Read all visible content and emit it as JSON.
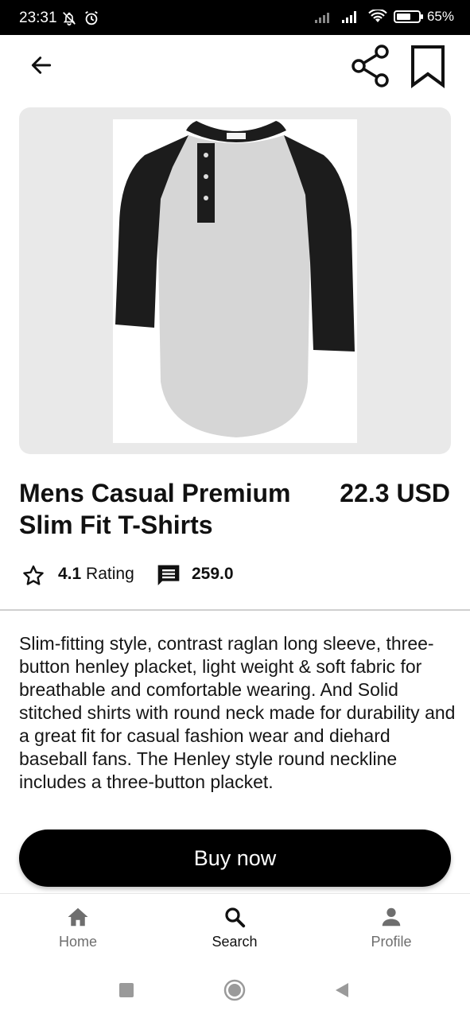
{
  "status_bar": {
    "time": "23:31",
    "battery_text": "65%",
    "battery_level": 0.65,
    "icons": [
      "muted-bell-icon",
      "alarm-icon",
      "signal-icon",
      "signal-icon",
      "wifi-icon",
      "battery-icon"
    ]
  },
  "top_bar": {
    "icons": [
      "back-arrow-icon",
      "share-icon",
      "bookmark-icon"
    ]
  },
  "product": {
    "image_icon": "henley-shirt-image",
    "title": "Mens Casual Premium Slim Fit T-Shirts",
    "price": "22.3 USD",
    "rating_value": "4.1",
    "rating_label": "Rating",
    "comments_count": "259.0",
    "description": "Slim-fitting style, contrast raglan long sleeve, three-button henley placket, light weight & soft fabric for breathable and comfortable wearing. And Solid stitched shirts with round neck made for durability and a great fit for casual fashion wear and diehard baseball fans. The Henley style round neckline includes a three-button placket."
  },
  "actions": {
    "buy_label": "Buy now"
  },
  "bottom_nav": {
    "items": [
      {
        "label": "Home",
        "icon": "home-icon"
      },
      {
        "label": "Search",
        "icon": "search-icon",
        "active": true
      },
      {
        "label": "Profile",
        "icon": "person-icon"
      }
    ]
  },
  "colors": {
    "primary": "#000000",
    "card_background": "#e9e9e9",
    "inactive_nav": "#6e6e6e"
  }
}
